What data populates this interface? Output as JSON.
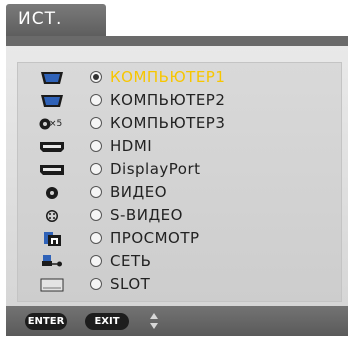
{
  "title": "ИСТ.",
  "items": [
    {
      "icon": "vga-port-icon",
      "label": "КОМПЬЮТЕР1",
      "selected": true
    },
    {
      "icon": "vga-port-icon",
      "label": "КОМПЬЮТЕР2",
      "selected": false
    },
    {
      "icon": "bnc-x5-icon",
      "icon_text": "×5",
      "label": "КОМПЬЮТЕР3",
      "selected": false
    },
    {
      "icon": "hdmi-port-icon",
      "label": "HDMI",
      "selected": false
    },
    {
      "icon": "displayport-icon",
      "label": "DisplayPort",
      "selected": false
    },
    {
      "icon": "rca-video-icon",
      "label": "ВИДЕО",
      "selected": false
    },
    {
      "icon": "s-video-icon",
      "label": "S-ВИДЕО",
      "selected": false
    },
    {
      "icon": "viewer-icon",
      "label": "ПРОСМОТР",
      "selected": false
    },
    {
      "icon": "network-icon",
      "label": "СЕТЬ",
      "selected": false
    },
    {
      "icon": "slot-icon",
      "label": "SLOT",
      "selected": false
    }
  ],
  "footer": {
    "enter_label": "ENTER",
    "exit_label": "EXIT",
    "nav_icon": "up-down-arrows-icon"
  },
  "colors": {
    "selected_text": "#f7c600",
    "text": "#222222",
    "header_bg": "#666666"
  }
}
